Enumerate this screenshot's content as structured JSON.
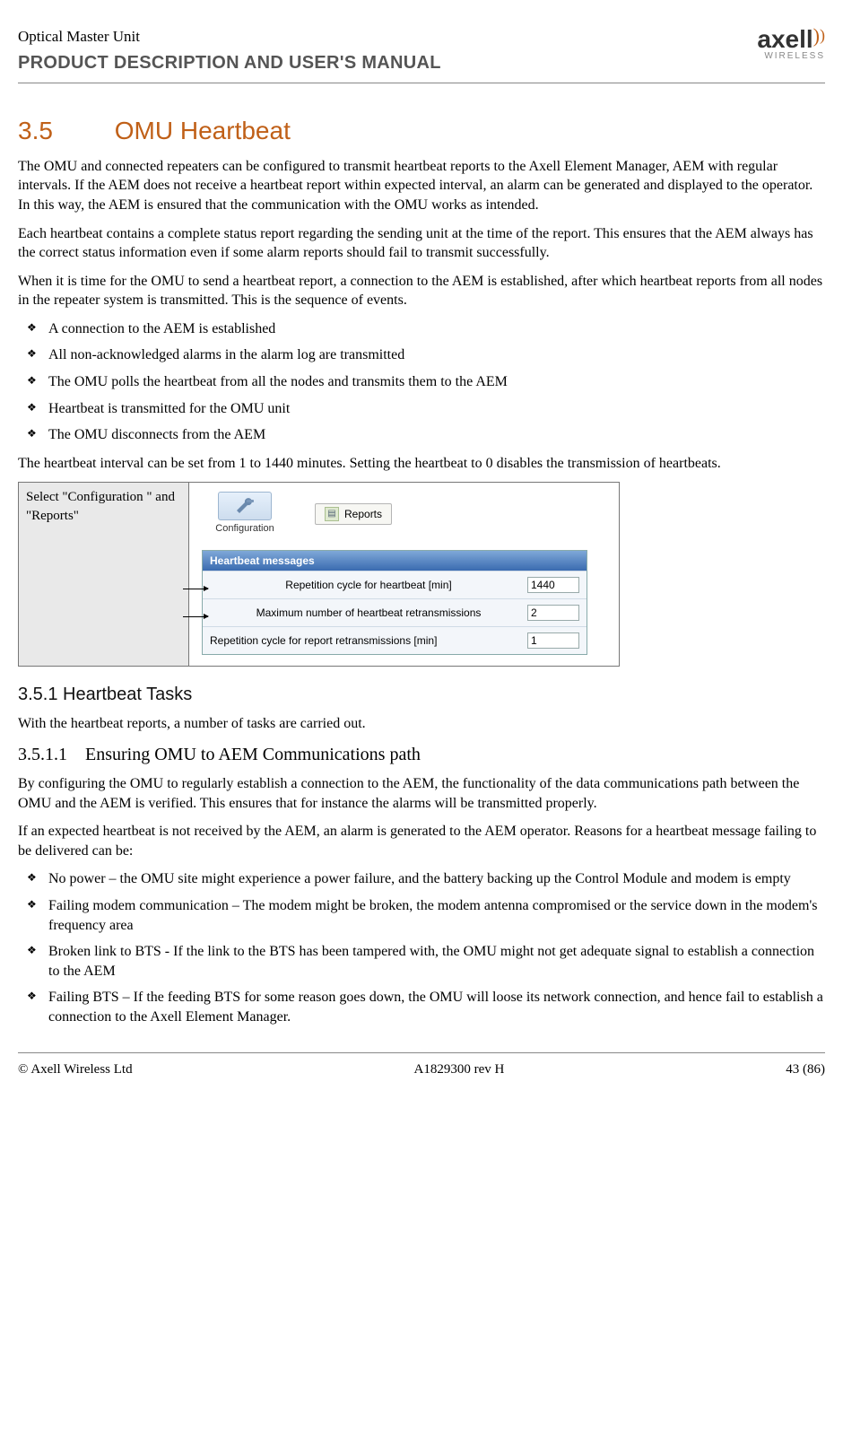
{
  "header": {
    "product": "Optical Master Unit",
    "manual": "PRODUCT DESCRIPTION AND USER'S MANUAL",
    "logo_text": "axell",
    "logo_sub": "WIRELESS"
  },
  "section": {
    "num": "3.5",
    "title": "OMU Heartbeat",
    "p1": "The OMU and connected repeaters can be configured to transmit heartbeat reports to the Axell Element Manager, AEM with regular intervals. If the AEM does not receive a heartbeat report within expected interval, an alarm can be generated and displayed to the operator. In this way, the AEM is ensured that the communication with the OMU works as intended.",
    "p2": "Each heartbeat contains a complete status report regarding the sending unit at the time of the report. This ensures that the AEM always has the correct status information even if some alarm reports should fail to transmit successfully.",
    "p3": "When it is time for the OMU to send a heartbeat report, a connection to the AEM is established, after which heartbeat reports from all nodes in the repeater system is transmitted. This is the sequence of events.",
    "bullets1": [
      "A connection to the AEM is established",
      "All non-acknowledged alarms in the alarm log are transmitted",
      "The OMU polls the heartbeat from all the nodes and transmits them to the AEM",
      "Heartbeat is transmitted for the OMU unit",
      "The OMU disconnects from the AEM"
    ],
    "p4": "The heartbeat interval can be set from 1 to 1440 minutes. Setting the heartbeat to 0 disables the transmission of heartbeats."
  },
  "shot": {
    "cell_label": "Select \"Configuration \" and \"Reports\"",
    "cfg_label": "Configuration",
    "rep_label": "Reports",
    "panel_title": "Heartbeat messages",
    "rows": [
      {
        "label": "Repetition cycle for heartbeat [min]",
        "value": "1440"
      },
      {
        "label": "Maximum number of heartbeat retransmissions",
        "value": "2"
      },
      {
        "label": "Repetition cycle for report retransmissions [min]",
        "value": "1"
      }
    ]
  },
  "sub": {
    "h3": "3.5.1 Heartbeat Tasks",
    "p1": "With the heartbeat reports, a number of tasks are carried out.",
    "h4_num": "3.5.1.1",
    "h4_title": "Ensuring OMU to AEM Communications path",
    "p2": "By configuring the OMU to regularly establish a connection to the AEM, the functionality of the data communications path between the OMU and the AEM is verified. This ensures that for instance the alarms will be transmitted properly.",
    "p3": "If an expected heartbeat is not received by the AEM, an alarm is generated to the AEM operator. Reasons for a heartbeat message failing to be delivered can be:",
    "bullets2": [
      "No power – the OMU site might experience a power failure, and the battery backing up the Control Module and modem is empty",
      "Failing modem communication – The modem might be broken, the modem antenna compromised or the service down in the modem's frequency area",
      "Broken link to BTS - If the link to the BTS has been tampered with, the OMU might not get adequate signal to establish a connection to the AEM",
      "Failing BTS – If the feeding BTS for some reason goes down, the OMU will loose its network connection, and hence fail to establish a connection to the Axell Element Manager."
    ]
  },
  "footer": {
    "left": "© Axell Wireless Ltd",
    "center": "A1829300 rev H",
    "right": "43 (86)"
  }
}
